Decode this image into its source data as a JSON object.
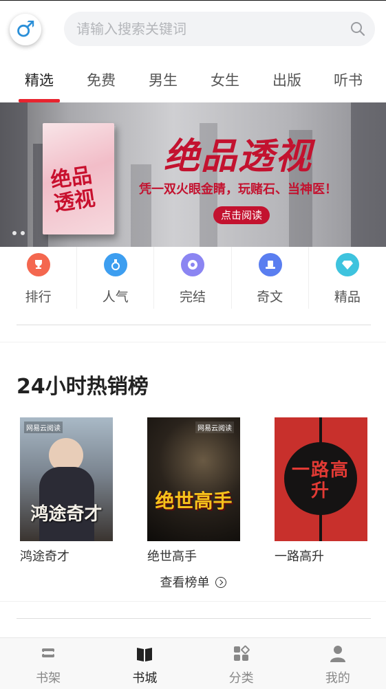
{
  "header": {
    "gender_symbol": "♂",
    "search_placeholder": "请输入搜索关键词"
  },
  "tabs": [
    {
      "label": "精选",
      "active": true
    },
    {
      "label": "免费"
    },
    {
      "label": "男生"
    },
    {
      "label": "女生"
    },
    {
      "label": "出版"
    },
    {
      "label": "听书"
    }
  ],
  "banner": {
    "book_title": "绝品透视",
    "title": "绝品透视",
    "subtitle": "凭一双火眼金睛，玩赌石、当神医！",
    "button": "点击阅读",
    "dots": 2
  },
  "categories": [
    {
      "label": "排行",
      "icon": "trophy-icon",
      "color": "#f4674f"
    },
    {
      "label": "人气",
      "icon": "medal-icon",
      "color": "#3d9ef0"
    },
    {
      "label": "完结",
      "icon": "target-icon",
      "color": "#8b85f2"
    },
    {
      "label": "奇文",
      "icon": "hat-icon",
      "color": "#5a7ef0"
    },
    {
      "label": "精品",
      "icon": "diamond-icon",
      "color": "#3ec3de"
    }
  ],
  "section": {
    "title": "24小时热销榜",
    "more_label": "查看榜单"
  },
  "books": [
    {
      "name": "鸿途奇才",
      "cover_title": "鸿途奇才",
      "brand": "网易云阅读"
    },
    {
      "name": "绝世高手",
      "cover_title": "绝世高手",
      "brand": "网易云阅读"
    },
    {
      "name": "一路高升",
      "cover_title": "一路高升"
    }
  ],
  "bottom_nav": [
    {
      "label": "书架",
      "icon": "bookshelf-icon"
    },
    {
      "label": "书城",
      "icon": "book-open-icon",
      "active": true
    },
    {
      "label": "分类",
      "icon": "category-icon"
    },
    {
      "label": "我的",
      "icon": "user-icon"
    }
  ],
  "colors": {
    "accent": "#e8242f",
    "banner_red": "#c3122f",
    "gender_blue": "#2a8fd8"
  }
}
